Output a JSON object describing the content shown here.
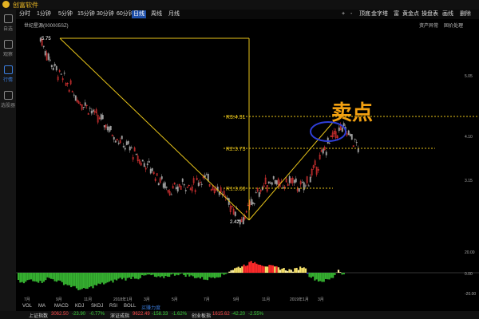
{
  "app": {
    "name": "创富软件"
  },
  "sidebar": {
    "items": [
      {
        "label": "自选",
        "icon": "star-icon",
        "active": false
      },
      {
        "label": "观察",
        "icon": "eye-icon",
        "active": false
      },
      {
        "label": "行情",
        "icon": "chart-icon",
        "active": true
      },
      {
        "label": "选股器",
        "icon": "filter-icon",
        "active": false
      }
    ]
  },
  "periods": [
    "分时",
    "1分钟",
    "5分钟",
    "15分钟",
    "30分钟",
    "60分钟",
    "日线",
    "周线",
    "月线"
  ],
  "active_period": "日线",
  "toolbar": {
    "items": [
      "+",
      "-",
      "顶底",
      "金字塔",
      "富",
      "黄金点",
      "操盘表",
      "画线",
      "删除"
    ]
  },
  "security": {
    "name": "世纪星源(000005SZ)"
  },
  "right_buttons": {
    "assets": "资产异常",
    "exright": "固价处理"
  },
  "main_chart": {
    "start_price_label": "5.75",
    "low_price_label": "2.42",
    "r1_label": "R1:3.00",
    "r2_label": "R2:3.73",
    "r3_label": "R3:4.31",
    "sell_annotation": "卖点",
    "y_ticks": [
      "5.05",
      "4.10",
      "3.15"
    ],
    "accent_color": "#e9c51a",
    "annotation_color": "#f2a011",
    "circle_color": "#2f3fd8"
  },
  "chart_data": {
    "type": "candlestick",
    "title": "世纪星源(000005SZ)",
    "ylim": [
      2.3,
      5.9
    ],
    "y_ticks": [
      5.05,
      4.1,
      3.15
    ],
    "support_resistance": {
      "R1": 3.0,
      "R2": 3.73,
      "R3": 4.31
    },
    "swing_points": [
      {
        "label": "high",
        "value": 5.75
      },
      {
        "label": "low",
        "value": 2.42
      }
    ],
    "price_path": [
      5.75,
      5.5,
      5.3,
      5.15,
      5.0,
      4.9,
      4.75,
      4.6,
      4.55,
      4.45,
      4.3,
      4.25,
      4.15,
      4.0,
      3.9,
      3.8,
      3.75,
      3.6,
      3.5,
      3.45,
      3.35,
      3.2,
      3.1,
      3.0,
      2.95,
      3.05,
      3.1,
      3.0,
      3.1,
      3.2,
      3.15,
      3.05,
      3.0,
      2.85,
      2.7,
      2.6,
      2.42,
      2.55,
      2.75,
      2.9,
      3.05,
      3.1,
      3.2,
      3.0,
      3.1,
      3.15,
      3.05,
      3.0,
      3.15,
      3.3,
      3.5,
      3.7,
      3.9,
      4.0,
      4.1,
      4.05,
      3.9,
      3.75
    ],
    "oscillator": {
      "y_ticks": [
        20.0,
        0.0,
        -20.0
      ],
      "values": [
        -8,
        -10,
        -6,
        -7,
        -9,
        -5,
        -6,
        -8,
        -10,
        -12,
        -14,
        -16,
        -15,
        -13,
        -11,
        -10,
        -9,
        -7,
        -5,
        -6,
        -4,
        -5,
        -3,
        -2,
        -4,
        -5,
        -3,
        -2,
        -1,
        -2,
        -3,
        -4,
        -5,
        -6,
        -4,
        -3,
        -2,
        2,
        4,
        6,
        8,
        10,
        9,
        7,
        6,
        5,
        4,
        3,
        2,
        4,
        6,
        -3,
        -6,
        -8,
        -7,
        -5,
        3,
        -2
      ]
    },
    "x_labels": [
      "7月",
      "9月",
      "11月",
      "2018年1月",
      "3月",
      "5月",
      "7月",
      "9月",
      "11月",
      "2019年1月",
      "3月"
    ]
  },
  "oscillator_ticks": [
    "20.00",
    "0.00",
    "-20.00"
  ],
  "indicator_tabs": [
    "VOL",
    "MA",
    "MACD",
    "KDJ",
    "SKDJ",
    "RSI",
    "BOLL",
    "买赚力度"
  ],
  "active_indicator": "买赚力度",
  "status": {
    "sh_label": "上证指数",
    "sh_value": "3062.50",
    "sh_change": "-23.90",
    "sh_pct": "-0.77%",
    "sz_label": "深证成指",
    "sz_value": "9622.49",
    "sz_change": "-158.33",
    "sz_pct": "-1.62%",
    "cy_label": "创业板指",
    "cy_value": "1615.62",
    "cy_change": "-42.20",
    "cy_pct": "-2.55%"
  }
}
